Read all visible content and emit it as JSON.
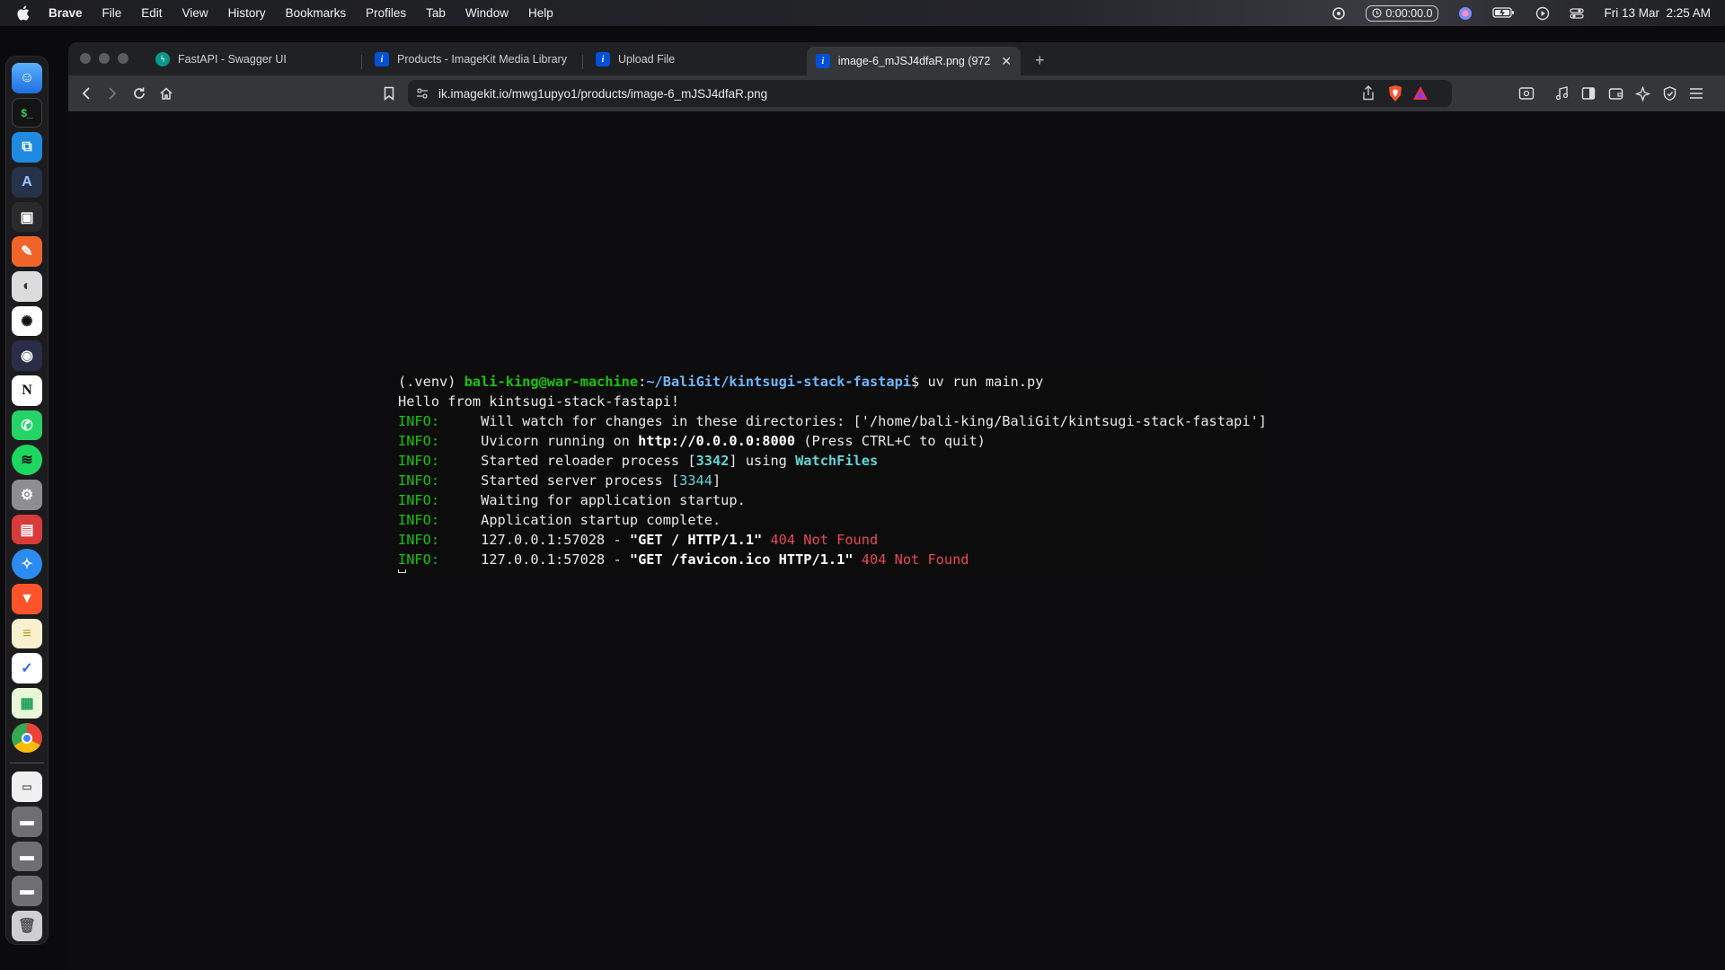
{
  "menubar": {
    "app": "Brave",
    "items": [
      "File",
      "Edit",
      "View",
      "History",
      "Bookmarks",
      "Profiles",
      "Tab",
      "Window",
      "Help"
    ],
    "timer": "0:00:00.0",
    "datetime": "Fri 13 Mar  2:25 AM"
  },
  "dock": {
    "apps": [
      {
        "name": "finder",
        "color": "#3b82f6",
        "glyph": "☺"
      },
      {
        "name": "terminal",
        "color": "#1a1a1a",
        "glyph": "$"
      },
      {
        "name": "vscode",
        "color": "#0f7ad8",
        "glyph": "⟨⟩"
      },
      {
        "name": "xcode-like",
        "color": "#2d3748",
        "glyph": "A"
      },
      {
        "name": "app-square",
        "color": "#222",
        "glyph": "▣"
      },
      {
        "name": "pen-app",
        "color": "#f2651d",
        "glyph": "✎"
      },
      {
        "name": "gimp",
        "color": "#e6e6e6",
        "glyph": "◐"
      },
      {
        "name": "chatgpt",
        "color": "#2f2f2f",
        "glyph": "✺"
      },
      {
        "name": "obs",
        "color": "#2a2a45",
        "glyph": "◉"
      },
      {
        "name": "notion",
        "color": "#ffffff",
        "glyph": "N"
      },
      {
        "name": "whatsapp",
        "color": "#25d366",
        "glyph": "✆"
      },
      {
        "name": "spotify",
        "color": "#111",
        "glyph": "≋"
      },
      {
        "name": "settings",
        "color": "#8a8a8e",
        "glyph": "⚙"
      },
      {
        "name": "calculator-app",
        "color": "#d93f3f",
        "glyph": "▤"
      },
      {
        "name": "safari",
        "color": "#1e90ff",
        "glyph": "✧"
      },
      {
        "name": "brave",
        "color": "#fb542b",
        "glyph": "▼"
      },
      {
        "name": "notes",
        "color": "#f5d76e",
        "glyph": "≡"
      },
      {
        "name": "tasks",
        "color": "#ffffff",
        "glyph": "✓"
      },
      {
        "name": "sheets",
        "color": "#22a565",
        "glyph": "▦"
      },
      {
        "name": "chrome",
        "color": "#ffffff",
        "glyph": "◎"
      }
    ],
    "folders": [
      "downloads-stack",
      "folder-1",
      "folder-2",
      "folder-3",
      "trash"
    ]
  },
  "tabs": [
    {
      "title": "FastAPI - Swagger UI",
      "favicon_color": "#05998b",
      "favicon_glyph": "ϟ"
    },
    {
      "title": "Products - ImageKit Media Library",
      "favicon_color": "#0450d5",
      "favicon_glyph": "i"
    },
    {
      "title": "Upload File",
      "favicon_color": "#0450d5",
      "favicon_glyph": "i"
    },
    {
      "title": "image-6_mJSJ4dfaR.png (972",
      "favicon_color": "#0450d5",
      "favicon_glyph": "i"
    }
  ],
  "address": {
    "url": "ik.imagekit.io/mwg1upyo1/products/image-6_mJSJ4dfaR.png"
  },
  "terminal": {
    "venv": "(.venv) ",
    "user_host": "bali-king@war-machine",
    "colon": ":",
    "path": "~/BaliGit/kintsugi-stack-fastapi",
    "prompt_cmd": "$ uv run main.py",
    "hello": "Hello from kintsugi-stack-fastapi!",
    "info_label": "INFO:",
    "watch": "     Will watch for changes in these directories: ['/home/bali-king/BaliGit/kintsugi-stack-fastapi']",
    "uvicorn_pre": "     Uvicorn running on ",
    "uvicorn_url": "http://0.0.0.0:8000",
    "uvicorn_post": " (Press CTRL+C to quit)",
    "reloader_pre": "     Started reloader process [",
    "reloader_pid": "3342",
    "reloader_mid": "] using ",
    "reloader_tool": "WatchFiles",
    "server_pre": "     Started server process [",
    "server_pid": "3344",
    "server_post": "]",
    "waiting": "     Waiting for application startup.",
    "complete": "     Application startup complete.",
    "req1_pre": "     127.0.0.1:57028 - ",
    "req1_path": "\"GET / HTTP/1.1\"",
    "req1_status": " 404 Not Found",
    "req2_pre": "     127.0.0.1:57028 - ",
    "req2_path": "\"GET /favicon.ico HTTP/1.1\"",
    "req2_status": " 404 Not Found"
  }
}
